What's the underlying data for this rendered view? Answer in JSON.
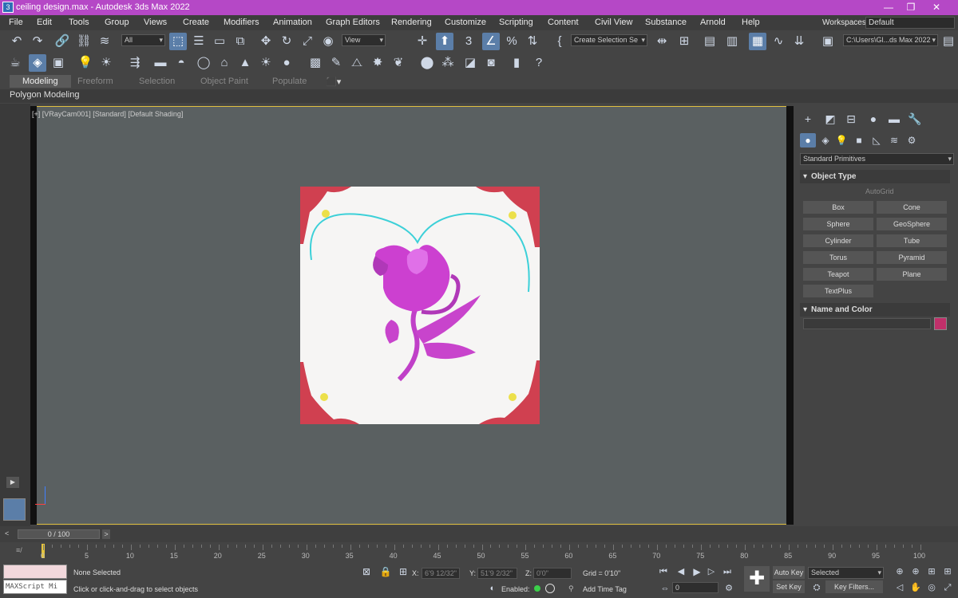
{
  "window": {
    "title": "ceiling design.max - Autodesk 3ds Max 2022",
    "minimize": "—",
    "restore": "❐",
    "close": "✕"
  },
  "menu": [
    "File",
    "Edit",
    "Tools",
    "Group",
    "Views",
    "Create",
    "Modifiers",
    "Animation",
    "Graph Editors",
    "Rendering",
    "Customize",
    "Scripting",
    "Content",
    "Civil View",
    "Substance",
    "Arnold",
    "Help"
  ],
  "workspaces": {
    "label": "Workspaces:",
    "value": "Default"
  },
  "toolbar": {
    "selection_filter": "All",
    "reference_coord": "View",
    "named_selection": "Create Selection Se",
    "project_path": "C:\\Users\\Gl...ds Max 2022"
  },
  "ribbon": {
    "tabs": [
      "Modeling",
      "Freeform",
      "Selection",
      "Object Paint",
      "Populate"
    ],
    "active": "Modeling",
    "sub": "Polygon Modeling"
  },
  "viewport": {
    "label": "[+] [VRayCam001] [Standard] [Default Shading]"
  },
  "command_panel": {
    "category": "Standard Primitives",
    "object_type_header": "Object Type",
    "autogrid": "AutoGrid",
    "buttons": [
      "Box",
      "Cone",
      "Sphere",
      "GeoSphere",
      "Cylinder",
      "Tube",
      "Torus",
      "Pyramid",
      "Teapot",
      "Plane",
      "TextPlus"
    ],
    "name_color_header": "Name and Color",
    "object_color": "#c0306a"
  },
  "timeline": {
    "frame_display": "0 / 100",
    "ticks": [
      "0",
      "5",
      "10",
      "15",
      "20",
      "25",
      "30",
      "35",
      "40",
      "45",
      "50",
      "55",
      "60",
      "65",
      "70",
      "75",
      "80",
      "85",
      "90",
      "95",
      "100"
    ]
  },
  "status": {
    "maxscript": "MAXScript Mi",
    "selection": "None Selected",
    "prompt": "Click or click-and-drag to select objects",
    "x_label": "X:",
    "x_value": "6'9 12/32\"",
    "y_label": "Y:",
    "y_value": "51'9 2/32\"",
    "z_label": "Z:",
    "z_value": "0'0\"",
    "grid": "Grid = 0'10\"",
    "enabled": "Enabled:",
    "add_time_tag": "Add Time Tag",
    "auto_key": "Auto Key",
    "set_key": "Set Key",
    "selected": "Selected",
    "key_filters": "Key Filters...",
    "frame": "0"
  }
}
